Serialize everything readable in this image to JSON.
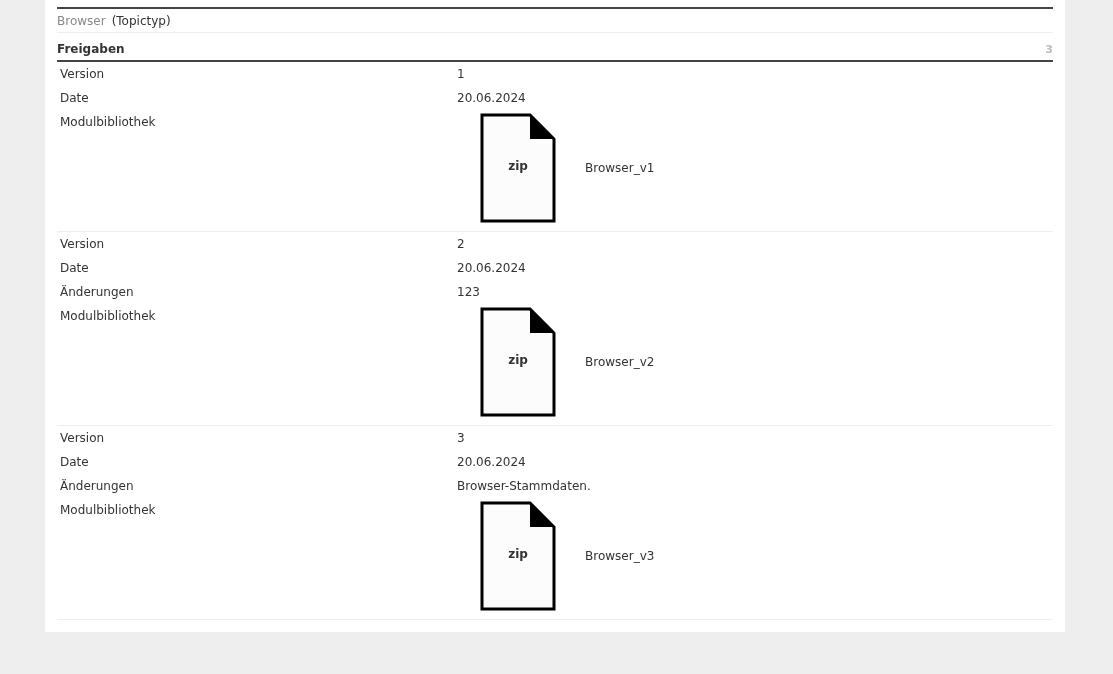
{
  "topic": {
    "name": "Browser",
    "type": "(Topictyp)"
  },
  "section": {
    "title": "Freigaben",
    "count": "3"
  },
  "releases": [
    {
      "fields": [
        {
          "kind": "text",
          "label": "Version",
          "value": "1"
        },
        {
          "kind": "text",
          "label": "Date",
          "value": "20.06.2024"
        },
        {
          "kind": "file",
          "label": "Modulbibliothek",
          "icon_text": "zip",
          "filename": "Browser_v1"
        }
      ]
    },
    {
      "fields": [
        {
          "kind": "text",
          "label": "Version",
          "value": "2"
        },
        {
          "kind": "text",
          "label": "Date",
          "value": "20.06.2024"
        },
        {
          "kind": "text",
          "label": "Änderungen",
          "value": "123"
        },
        {
          "kind": "file",
          "label": "Modulbibliothek",
          "icon_text": "zip",
          "filename": "Browser_v2"
        }
      ]
    },
    {
      "fields": [
        {
          "kind": "text",
          "label": "Version",
          "value": "3"
        },
        {
          "kind": "text",
          "label": "Date",
          "value": "20.06.2024"
        },
        {
          "kind": "text",
          "label": "Änderungen",
          "value": "Browser-Stammdaten."
        },
        {
          "kind": "file",
          "label": "Modulbibliothek",
          "icon_text": "zip",
          "filename": "Browser_v3"
        }
      ]
    }
  ]
}
